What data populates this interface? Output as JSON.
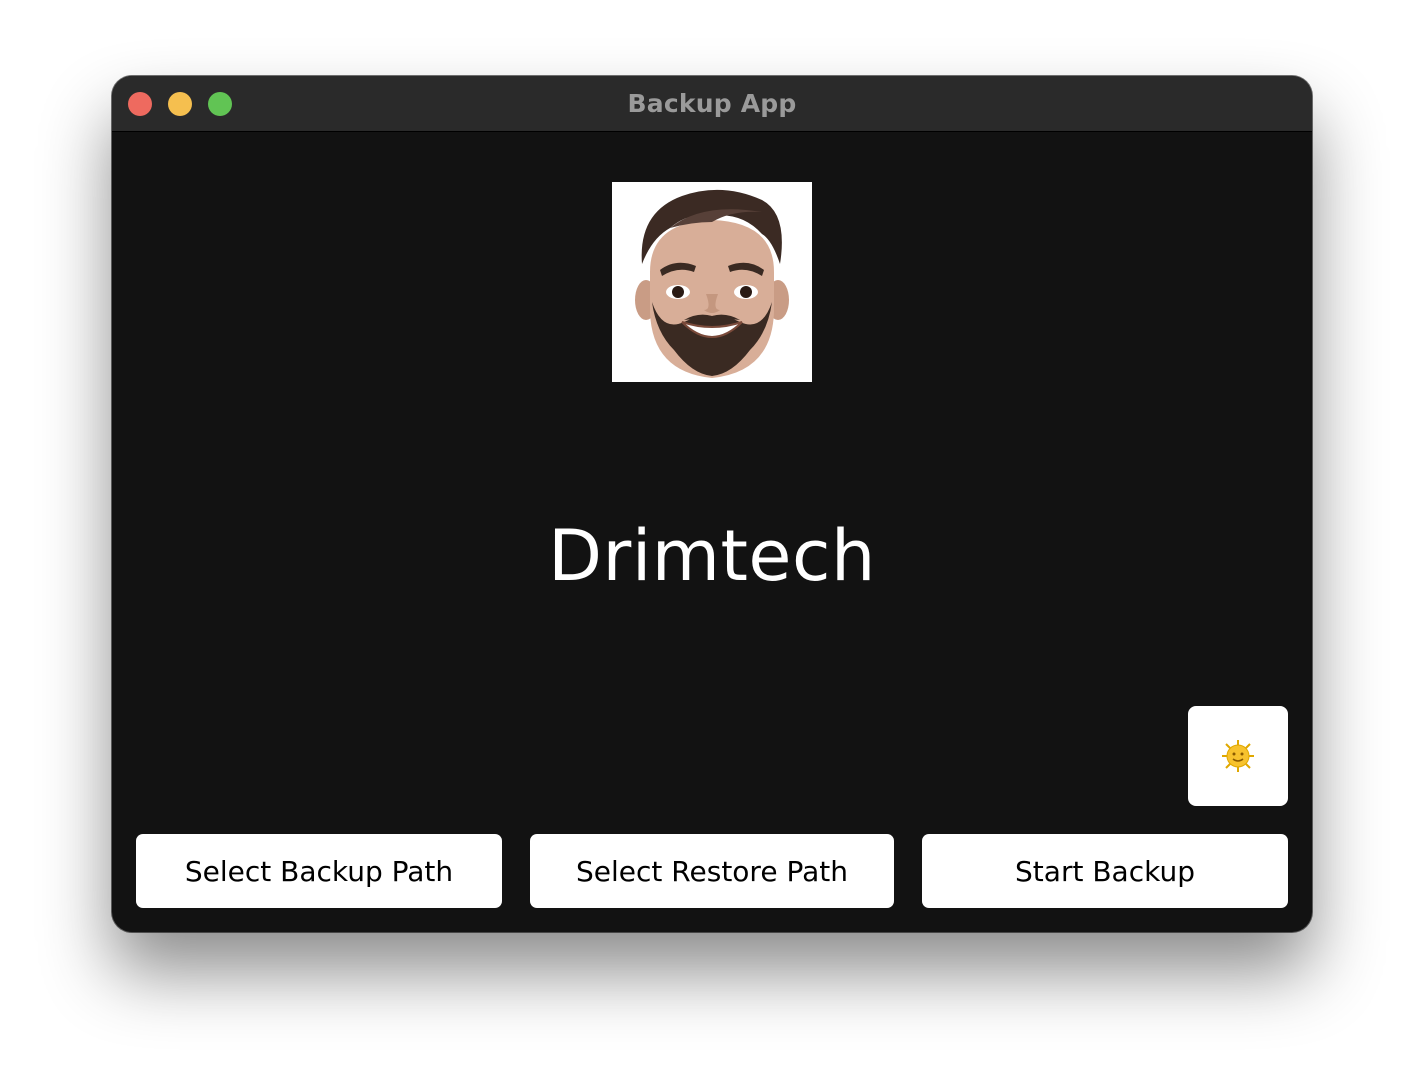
{
  "window": {
    "title": "Backup App",
    "traffic_lights": [
      "close",
      "minimize",
      "maximize"
    ]
  },
  "main": {
    "avatar_icon": "memoji-avatar",
    "brand_name": "Drimtech",
    "theme_toggle_icon": "sun-icon"
  },
  "actions": {
    "select_backup_label": "Select Backup Path",
    "select_restore_label": "Select Restore Path",
    "start_backup_label": "Start Backup"
  },
  "colors": {
    "window_bg": "#121212",
    "titlebar_bg": "#2a2a2a",
    "button_bg": "#ffffff",
    "close": "#ee6a5f",
    "minimize": "#f5bf4f",
    "maximize": "#61c454"
  }
}
